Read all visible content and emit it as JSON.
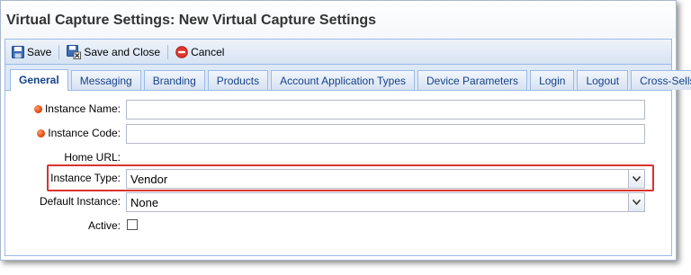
{
  "window": {
    "title": "Virtual Capture Settings: New Virtual Capture Settings"
  },
  "toolbar": {
    "save_label": "Save",
    "save_close_label": "Save and Close",
    "cancel_label": "Cancel"
  },
  "tabs": [
    {
      "label": "General",
      "active": true
    },
    {
      "label": "Messaging"
    },
    {
      "label": "Branding"
    },
    {
      "label": "Products"
    },
    {
      "label": "Account Application Types"
    },
    {
      "label": "Device Parameters"
    },
    {
      "label": "Login"
    },
    {
      "label": "Logout"
    },
    {
      "label": "Cross-Sells"
    }
  ],
  "form": {
    "instance_name": {
      "label": "Instance Name:",
      "value": "",
      "required": true
    },
    "instance_code": {
      "label": "Instance Code:",
      "value": "",
      "required": true
    },
    "home_url": {
      "label": "Home URL:",
      "value": ""
    },
    "instance_type": {
      "label": "Instance Type:",
      "value": "Vendor"
    },
    "default_instance": {
      "label": "Default Instance:",
      "value": "None"
    },
    "active": {
      "label": "Active:",
      "checked": false
    }
  },
  "colors": {
    "required_marker": "#e04b12",
    "highlight_border": "#d9332f",
    "tab_text": "#15428b",
    "panel_border": "#99bbe8"
  },
  "icons": {
    "save": "floppy-disk-icon",
    "save_close": "floppy-disk-close-icon",
    "cancel": "cancel-icon",
    "dropdown": "chevron-down-icon"
  }
}
